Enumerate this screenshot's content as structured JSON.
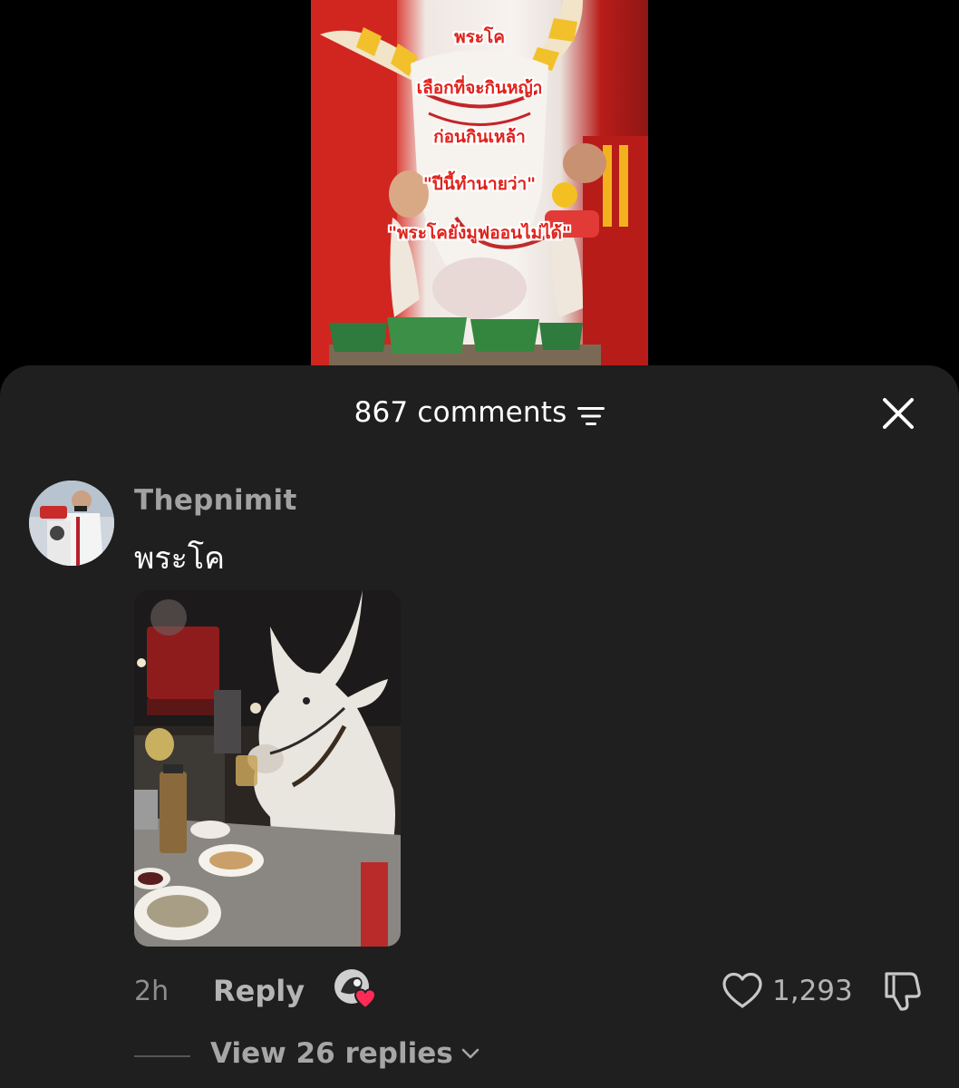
{
  "video": {
    "overlay_lines": [
      "พระโค",
      "เลือกที่จะกินหญ้า",
      "ก่อนกินเหล้า",
      "\"ปีนี้ทำนายว่า\"",
      "\"พระโคยังมูฟออนไม่ได้\""
    ],
    "overlay_color": "#e0221c"
  },
  "sheet": {
    "comment_count_label": "867 comments",
    "sort_icon": "sort-lines-icon",
    "close_icon": "close-x-icon"
  },
  "comments": [
    {
      "username": "Thepnimit",
      "text": "พระโค",
      "attached_image": "photo of a white ox seated at a street-food table holding a glass",
      "timestamp": "2h",
      "reply_label": "Reply",
      "creator_liked": true,
      "like_count": "1,293",
      "replies_label": "View 26 replies"
    }
  ],
  "colors": {
    "sheet_background": "#1f1f1f",
    "heart_red": "#fe2c55"
  }
}
